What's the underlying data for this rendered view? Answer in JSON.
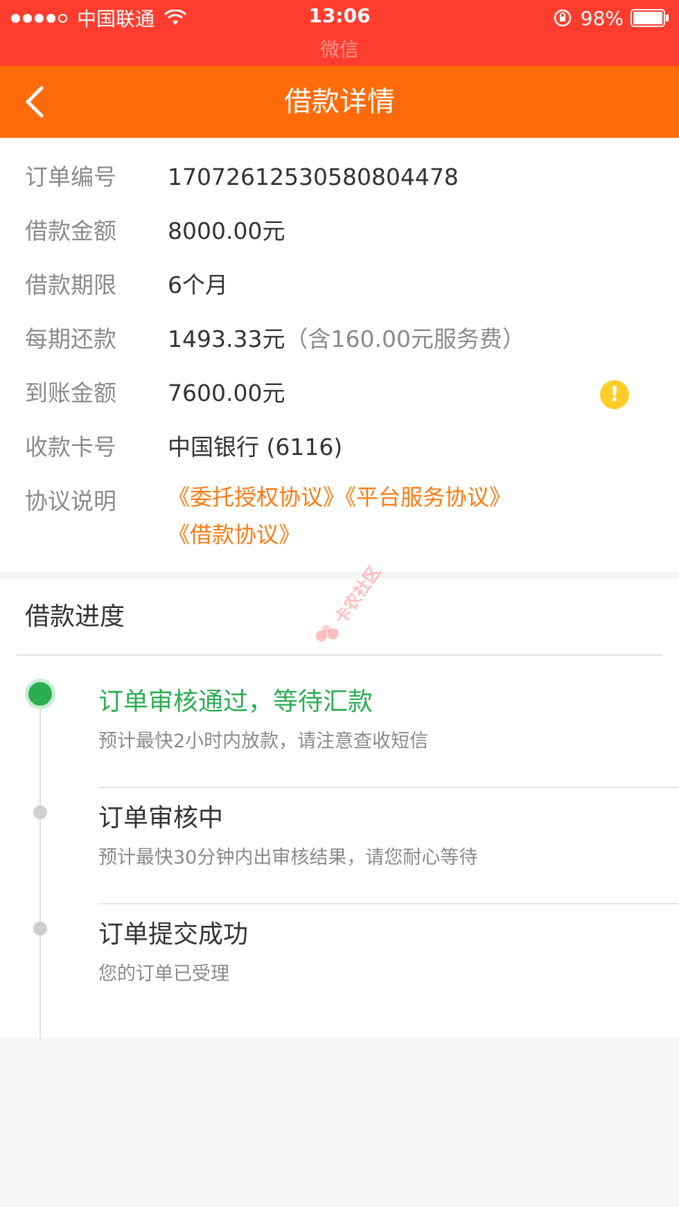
{
  "status_bar": {
    "carrier": "中国联通",
    "time": "13:06",
    "app_name": "微信",
    "battery": "98%"
  },
  "nav": {
    "title": "借款详情"
  },
  "details": {
    "rows": [
      {
        "label": "订单编号",
        "value": "170726125305808044​78"
      },
      {
        "label": "借款金额",
        "value": "8000.00元"
      },
      {
        "label": "借款期限",
        "value": "6个月"
      },
      {
        "label": "每期还款",
        "value": "1493.33元",
        "note": "（含160.00元服务费）"
      },
      {
        "label": "到账金额",
        "value": "7600.00元"
      },
      {
        "label": "收款卡号",
        "value": "中国银行 (6116)"
      },
      {
        "label": "协议说明",
        "value": ""
      }
    ],
    "protocols": [
      "《委托授权协议》",
      "《平台服务协议》",
      "《借款协议》"
    ],
    "warning_symbol": "!"
  },
  "progress": {
    "title": "借款进度",
    "steps": [
      {
        "title": "订单审核通过，等待汇款",
        "desc": "预计最快2小时内放款，请注意查收短信",
        "active": true
      },
      {
        "title": "订单审核中",
        "desc": "预计最快30分钟内出审核结果，请您耐心等待",
        "active": false
      },
      {
        "title": "订单提交成功",
        "desc": "您的订单已受理",
        "active": false
      }
    ]
  },
  "watermark": {
    "text": "卡农社区"
  },
  "colors": {
    "status_bar_bg": "#ff3d2e",
    "nav_bg": "#ff6b0a",
    "link": "#ff7a12",
    "active_green": "#2cad52",
    "warning_yellow": "#ffcc2a"
  }
}
